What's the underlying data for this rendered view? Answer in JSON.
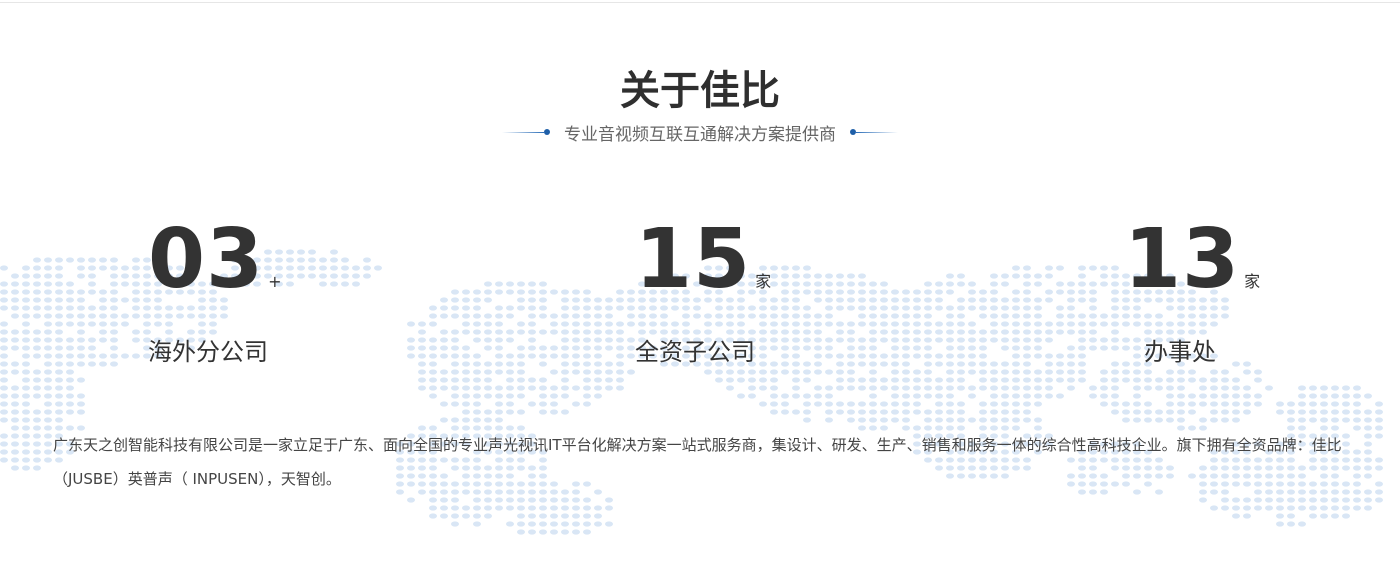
{
  "about": {
    "title": "关于佳比",
    "subtitle": "专业音视频互联互通解决方案提供商"
  },
  "stats": [
    {
      "value": "03",
      "suffix": "+",
      "label": "海外分公司"
    },
    {
      "value": "15",
      "suffix": "家",
      "label": "全资子公司"
    },
    {
      "value": "13",
      "suffix": "家",
      "label": "办事处"
    }
  ],
  "intro_text": "广东天之创智能科技有限公司是一家立足于广东、面向全国的专业声光视讯IT平台化解决方案一站式服务商，集设计、研发、生产、销售和服务一体的综合性高科技企业。旗下拥有全资品牌：佳比（JUSBE）英普声（ INPUSEN），天智创。",
  "colors": {
    "accent": "#1f5fa8",
    "map_dots": "#d9e6f5",
    "text": "#333333"
  }
}
